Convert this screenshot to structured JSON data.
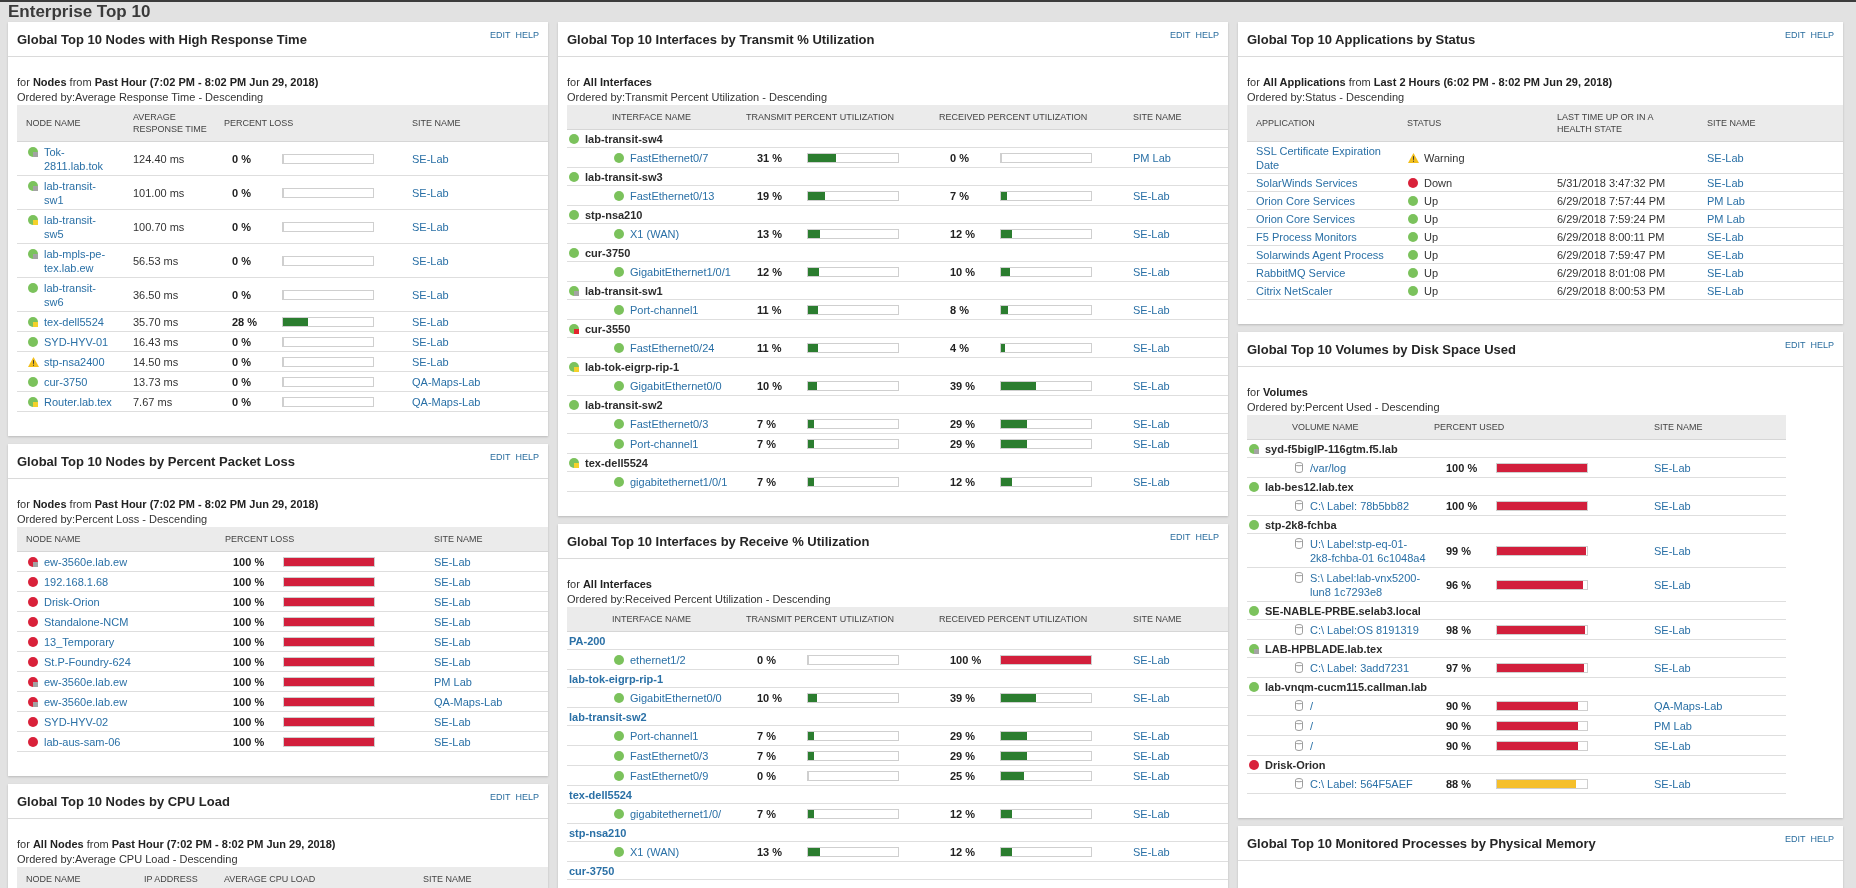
{
  "page": {
    "title": "Enterprise Top 10"
  },
  "panel_columns": [
    [
      {
        "kind": "response_time",
        "title": "Global Top 10 Nodes with High Response Time",
        "actions": [
          "EDIT",
          "HELP"
        ],
        "filter": "for **Nodes** from **Past Hour (7:02 PM - 8:02 PM Jun 29, 2018)**",
        "ordered_by": "Ordered by:Average Response Time - Descending",
        "columns": [
          "NODE NAME",
          "AVERAGE RESPONSE TIME",
          "PERCENT LOSS",
          "SITE NAME"
        ],
        "rows": [
          {
            "name": "Tok-2811.lab.tok",
            "warning": false,
            "color": "#7bc25c",
            "badge": {
              "color": "#a3a3a3"
            },
            "response_time": "124.40 ms",
            "loss": {
              "reading": "0 %",
              "level": 0
            },
            "site": "SE-Lab"
          },
          {
            "name": "lab-transit-sw1",
            "warning": false,
            "color": "#7bc25c",
            "badge": {
              "color": "#a3a3a3"
            },
            "response_time": "101.00 ms",
            "loss": {
              "reading": "0 %",
              "level": 0
            },
            "site": "SE-Lab"
          },
          {
            "name": "lab-transit-sw5",
            "warning": false,
            "color": "#7bc25c",
            "badge": {
              "color": "#f4d12b"
            },
            "response_time": "100.70 ms",
            "loss": {
              "reading": "0 %",
              "level": 0
            },
            "site": "SE-Lab"
          },
          {
            "name": "lab-mpls-pe-tex.lab.ew",
            "warning": false,
            "color": "#7bc25c",
            "badge": {
              "color": "#a3a3a3"
            },
            "response_time": "56.53 ms",
            "loss": {
              "reading": "0 %",
              "level": 0
            },
            "site": "SE-Lab"
          },
          {
            "name": "lab-transit-sw6",
            "warning": false,
            "color": "#7bc25c",
            "response_time": "36.50 ms",
            "loss": {
              "reading": "0 %",
              "level": 0
            },
            "site": "SE-Lab"
          },
          {
            "name": "tex-dell5524",
            "warning": false,
            "color": "#7bc25c",
            "badge": {
              "color": "#f4d12b"
            },
            "response_time": "35.70 ms",
            "loss": {
              "reading": "28 %",
              "level": 0.28
            },
            "site": "SE-Lab"
          },
          {
            "name": "SYD-HYV-01",
            "warning": false,
            "color": "#7bc25c",
            "response_time": "16.43 ms",
            "loss": {
              "reading": "0 %",
              "level": 0
            },
            "site": "SE-Lab"
          },
          {
            "name": "stp-nsa2400",
            "warning": true,
            "response_time": "14.50 ms",
            "loss": {
              "reading": "0 %",
              "level": 0
            },
            "site": "SE-Lab"
          },
          {
            "name": "cur-3750",
            "warning": false,
            "color": "#7bc25c",
            "response_time": "13.73 ms",
            "loss": {
              "reading": "0 %",
              "level": 0
            },
            "site": "QA-Maps-Lab"
          },
          {
            "name": "Router.lab.tex",
            "warning": false,
            "color": "#7bc25c",
            "badge": {
              "color": "#f4d12b"
            },
            "response_time": "7.67 ms",
            "loss": {
              "reading": "0 %",
              "level": 0
            },
            "site": "QA-Maps-Lab"
          }
        ]
      },
      {
        "kind": "packet_loss",
        "title": "Global Top 10 Nodes by Percent Packet Loss",
        "actions": [
          "EDIT",
          "HELP"
        ],
        "filter": "for **Nodes** from **Past Hour (7:02 PM - 8:02 PM Jun 29, 2018)**",
        "ordered_by": "Ordered by:Percent Loss - Descending",
        "columns": [
          "NODE NAME",
          "PERCENT LOSS",
          "SITE NAME"
        ],
        "rows": [
          {
            "name": "ew-3560e.lab.ew",
            "color": "#d9213a",
            "badge": {
              "color": "#a3a3a3"
            },
            "loss": {
              "reading": "100 %",
              "level": 1
            },
            "site": "SE-Lab"
          },
          {
            "name": "192.168.1.68",
            "color": "#d9213a",
            "loss": {
              "reading": "100 %",
              "level": 1
            },
            "site": "SE-Lab"
          },
          {
            "name": "Drisk-Orion",
            "color": "#d9213a",
            "loss": {
              "reading": "100 %",
              "level": 1
            },
            "site": "SE-Lab"
          },
          {
            "name": "Standalone-NCM",
            "color": "#d9213a",
            "loss": {
              "reading": "100 %",
              "level": 1
            },
            "site": "SE-Lab"
          },
          {
            "name": "13_Temporary",
            "color": "#d9213a",
            "loss": {
              "reading": "100 %",
              "level": 1
            },
            "site": "SE-Lab"
          },
          {
            "name": "St.P-Foundry-624",
            "color": "#d9213a",
            "loss": {
              "reading": "100 %",
              "level": 1
            },
            "site": "SE-Lab"
          },
          {
            "name": "ew-3560e.lab.ew",
            "color": "#d9213a",
            "badge": {
              "color": "#a3a3a3"
            },
            "loss": {
              "reading": "100 %",
              "level": 1
            },
            "site": "PM Lab"
          },
          {
            "name": "ew-3560e.lab.ew",
            "color": "#d9213a",
            "badge": {
              "color": "#a3a3a3"
            },
            "loss": {
              "reading": "100 %",
              "level": 1
            },
            "site": "QA-Maps-Lab"
          },
          {
            "name": "SYD-HYV-02",
            "color": "#d9213a",
            "loss": {
              "reading": "100 %",
              "level": 1
            },
            "site": "SE-Lab"
          },
          {
            "name": "lab-aus-sam-06",
            "color": "#d9213a",
            "loss": {
              "reading": "100 %",
              "level": 1
            },
            "site": "SE-Lab"
          }
        ]
      },
      {
        "kind": "cpu_load",
        "title": "Global Top 10 Nodes by CPU Load",
        "actions": [
          "EDIT",
          "HELP"
        ],
        "filter": "for **All Nodes** from **Past Hour (7:02 PM - 8:02 PM Jun 29, 2018)**",
        "ordered_by": "Ordered by:Average CPU Load - Descending",
        "columns": [
          "NODE NAME",
          "IP ADDRESS",
          "AVERAGE CPU LOAD",
          "SITE NAME"
        ]
      }
    ],
    [
      {
        "kind": "interfaces",
        "title": "Global Top 10 Interfaces by Transmit % Utilization",
        "actions": [
          "EDIT",
          "HELP"
        ],
        "filter": "for **All Interfaces**",
        "ordered_by": "Ordered by:Transmit Percent Utilization - Descending",
        "columns": [
          "INTERFACE NAME",
          "TRANSMIT PERCENT UTILIZATION",
          "RECEIVED PERCENT UTILIZATION",
          "SITE NAME"
        ],
        "group_links": false,
        "groups": [
          {
            "name": "lab-transit-sw4",
            "color": "#7bc25c",
            "interfaces": [
              {
                "name": "FastEthernet0/7",
                "color": "#7bc25c",
                "transmit": {
                  "reading": "31 %",
                  "level": 0.31
                },
                "received": {
                  "reading": "0 %",
                  "level": 0
                },
                "site": "PM Lab"
              }
            ]
          },
          {
            "name": "lab-transit-sw3",
            "color": "#7bc25c",
            "interfaces": [
              {
                "name": "FastEthernet0/13",
                "color": "#7bc25c",
                "transmit": {
                  "reading": "19 %",
                  "level": 0.19
                },
                "received": {
                  "reading": "7 %",
                  "level": 0.07
                },
                "site": "SE-Lab"
              }
            ]
          },
          {
            "name": "stp-nsa210",
            "color": "#7bc25c",
            "interfaces": [
              {
                "name": "X1 (WAN)",
                "color": "#7bc25c",
                "transmit": {
                  "reading": "13 %",
                  "level": 0.13
                },
                "received": {
                  "reading": "12 %",
                  "level": 0.12
                },
                "site": "SE-Lab"
              }
            ]
          },
          {
            "name": "cur-3750",
            "color": "#7bc25c",
            "interfaces": [
              {
                "name": "GigabitEthernet1/0/1",
                "color": "#7bc25c",
                "transmit": {
                  "reading": "12 %",
                  "level": 0.12
                },
                "received": {
                  "reading": "10 %",
                  "level": 0.1
                },
                "site": "SE-Lab"
              }
            ]
          },
          {
            "name": "lab-transit-sw1",
            "color": "#7bc25c",
            "badge": {
              "color": "#a3a3a3"
            },
            "interfaces": [
              {
                "name": "Port-channel1",
                "color": "#7bc25c",
                "transmit": {
                  "reading": "11 %",
                  "level": 0.11
                },
                "received": {
                  "reading": "8 %",
                  "level": 0.08
                },
                "site": "SE-Lab"
              }
            ]
          },
          {
            "name": "cur-3550",
            "color": "#7bc25c",
            "badge": {
              "color": "#e3262f"
            },
            "interfaces": [
              {
                "name": "FastEthernet0/24",
                "color": "#7bc25c",
                "transmit": {
                  "reading": "11 %",
                  "level": 0.11
                },
                "received": {
                  "reading": "4 %",
                  "level": 0.04
                },
                "site": "SE-Lab"
              }
            ]
          },
          {
            "name": "lab-tok-eigrp-rip-1",
            "color": "#7bc25c",
            "badge": {
              "color": "#f4d12b"
            },
            "interfaces": [
              {
                "name": "GigabitEthernet0/0",
                "color": "#7bc25c",
                "transmit": {
                  "reading": "10 %",
                  "level": 0.1
                },
                "received": {
                  "reading": "39 %",
                  "level": 0.39
                },
                "site": "SE-Lab"
              }
            ]
          },
          {
            "name": "lab-transit-sw2",
            "color": "#7bc25c",
            "interfaces": [
              {
                "name": "FastEthernet0/3",
                "color": "#7bc25c",
                "transmit": {
                  "reading": "7 %",
                  "level": 0.07
                },
                "received": {
                  "reading": "29 %",
                  "level": 0.29
                },
                "site": "SE-Lab"
              },
              {
                "name": "Port-channel1",
                "color": "#7bc25c",
                "transmit": {
                  "reading": "7 %",
                  "level": 0.07
                },
                "received": {
                  "reading": "29 %",
                  "level": 0.29
                },
                "site": "SE-Lab"
              }
            ]
          },
          {
            "name": "tex-dell5524",
            "color": "#7bc25c",
            "badge": {
              "color": "#f4d12b"
            },
            "interfaces": [
              {
                "name": "gigabitethernet1/0/1",
                "color": "#7bc25c",
                "transmit": {
                  "reading": "7 %",
                  "level": 0.07
                },
                "received": {
                  "reading": "12 %",
                  "level": 0.12
                },
                "site": "SE-Lab"
              }
            ]
          }
        ]
      },
      {
        "kind": "interfaces",
        "title": "Global Top 10 Interfaces by Receive % Utilization",
        "actions": [
          "EDIT",
          "HELP"
        ],
        "filter": "for **All Interfaces**",
        "ordered_by": "Ordered by:Received Percent Utilization - Descending",
        "columns": [
          "INTERFACE NAME",
          "TRANSMIT PERCENT UTILIZATION",
          "RECEIVED PERCENT UTILIZATION",
          "SITE NAME"
        ],
        "group_links": true,
        "groups": [
          {
            "name": "PA-200",
            "interfaces": [
              {
                "name": "ethernet1/2",
                "color": "#7bc25c",
                "transmit": {
                  "reading": "0 %",
                  "level": 0
                },
                "received": {
                  "reading": "100 %",
                  "level": 1
                },
                "site": "SE-Lab"
              }
            ]
          },
          {
            "name": "lab-tok-eigrp-rip-1",
            "interfaces": [
              {
                "name": "GigabitEthernet0/0",
                "color": "#7bc25c",
                "transmit": {
                  "reading": "10 %",
                  "level": 0.1
                },
                "received": {
                  "reading": "39 %",
                  "level": 0.39
                },
                "site": "SE-Lab"
              }
            ]
          },
          {
            "name": "lab-transit-sw2",
            "interfaces": [
              {
                "name": "Port-channel1",
                "color": "#7bc25c",
                "transmit": {
                  "reading": "7 %",
                  "level": 0.07
                },
                "received": {
                  "reading": "29 %",
                  "level": 0.29
                },
                "site": "SE-Lab"
              },
              {
                "name": "FastEthernet0/3",
                "color": "#7bc25c",
                "transmit": {
                  "reading": "7 %",
                  "level": 0.07
                },
                "received": {
                  "reading": "29 %",
                  "level": 0.29
                },
                "site": "SE-Lab"
              },
              {
                "name": "FastEthernet0/9",
                "color": "#7bc25c",
                "transmit": {
                  "reading": "0 %",
                  "level": 0
                },
                "received": {
                  "reading": "25 %",
                  "level": 0.25
                },
                "site": "SE-Lab"
              }
            ]
          },
          {
            "name": "tex-dell5524",
            "interfaces": [
              {
                "name": "gigabitethernet1/0/",
                "color": "#7bc25c",
                "transmit": {
                  "reading": "7 %",
                  "level": 0.07
                },
                "received": {
                  "reading": "12 %",
                  "level": 0.12
                },
                "site": "SE-Lab"
              }
            ]
          },
          {
            "name": "stp-nsa210",
            "interfaces": [
              {
                "name": "X1 (WAN)",
                "color": "#7bc25c",
                "transmit": {
                  "reading": "13 %",
                  "level": 0.13
                },
                "received": {
                  "reading": "12 %",
                  "level": 0.12
                },
                "site": "SE-Lab"
              }
            ]
          },
          {
            "name": "cur-3750"
          }
        ]
      }
    ],
    [
      {
        "kind": "applications",
        "title": "Global Top 10 Applications by Status",
        "actions": [
          "EDIT",
          "HELP"
        ],
        "filter": "for **All Applications** from **Last 2 Hours (6:02 PM - 8:02 PM Jun 29, 2018)**",
        "ordered_by": "Ordered by:Status - Descending",
        "columns": [
          "APPLICATION",
          "STATUS",
          "LAST TIME UP OR IN A HEALTH STATE",
          "SITE NAME"
        ],
        "rows": [
          {
            "name": "SSL Certificate Expiration Date",
            "warning": true,
            "status_text": "Warning",
            "site": "SE-Lab"
          },
          {
            "name": "SolarWinds Services",
            "warning": false,
            "color": "#d9213a",
            "status_text": "Down",
            "last_up": "5/31/2018 3:47:32 PM",
            "site": "SE-Lab"
          },
          {
            "name": "Orion Core Services",
            "warning": false,
            "color": "#7bc25c",
            "status_text": "Up",
            "last_up": "6/29/2018 7:57:44 PM",
            "site": "PM Lab"
          },
          {
            "name": "Orion Core Services",
            "warning": false,
            "color": "#7bc25c",
            "status_text": "Up",
            "last_up": "6/29/2018 7:59:24 PM",
            "site": "PM Lab"
          },
          {
            "name": "F5 Process Monitors",
            "warning": false,
            "color": "#7bc25c",
            "status_text": "Up",
            "last_up": "6/29/2018 8:00:11 PM",
            "site": "SE-Lab"
          },
          {
            "name": "Solarwinds Agent Process",
            "warning": false,
            "color": "#7bc25c",
            "status_text": "Up",
            "last_up": "6/29/2018 7:59:47 PM",
            "site": "SE-Lab"
          },
          {
            "name": "RabbitMQ Service",
            "warning": false,
            "color": "#7bc25c",
            "status_text": "Up",
            "last_up": "6/29/2018 8:01:08 PM",
            "site": "SE-Lab"
          },
          {
            "name": "Citrix NetScaler",
            "warning": false,
            "color": "#7bc25c",
            "status_text": "Up",
            "last_up": "6/29/2018 8:00:53 PM",
            "site": "SE-Lab"
          }
        ]
      },
      {
        "kind": "volumes",
        "title": "Global Top 10 Volumes by Disk Space Used",
        "actions": [
          "EDIT",
          "HELP"
        ],
        "filter": "for **Volumes**",
        "ordered_by": "Ordered by:Percent Used - Descending",
        "columns": [
          "VOLUME NAME",
          "PERCENT USED",
          "SITE NAME"
        ],
        "groups": [
          {
            "name": "syd-f5bigIP-116gtm.f5.lab",
            "color": "#7bc25c",
            "badge": {
              "color": "#a3a3a3"
            },
            "volumes": [
              {
                "name": "/var/log",
                "used": {
                  "reading": "100 %",
                  "level": 1
                },
                "site": "SE-Lab"
              }
            ]
          },
          {
            "name": "lab-bes12.lab.tex",
            "color": "#7bc25c",
            "volumes": [
              {
                "name": "C:\\ Label: 78b5bb82",
                "used": {
                  "reading": "100 %",
                  "level": 1
                },
                "site": "SE-Lab"
              }
            ]
          },
          {
            "name": "stp-2k8-fchba",
            "color": "#7bc25c",
            "volumes": [
              {
                "name": "U:\\ Label:stp-eq-01-2k8-fchba-01 6c1048a4",
                "used": {
                  "reading": "99 %",
                  "level": 0.99
                },
                "site": "SE-Lab"
              },
              {
                "name": "S:\\ Label:lab-vnx5200-lun8 1c7293e8",
                "used": {
                  "reading": "96 %",
                  "level": 0.96
                },
                "site": "SE-Lab"
              }
            ]
          },
          {
            "name": "SE-NABLE-PRBE.selab3.local",
            "color": "#7bc25c",
            "volumes": [
              {
                "name": "C:\\ Label:OS 8191319",
                "used": {
                  "reading": "98 %",
                  "level": 0.98
                },
                "site": "SE-Lab"
              }
            ]
          },
          {
            "name": "LAB-HPBLADE.lab.tex",
            "color": "#7bc25c",
            "badge": {
              "color": "#a3a3a3"
            },
            "volumes": [
              {
                "name": "C:\\ Label: 3add7231",
                "used": {
                  "reading": "97 %",
                  "level": 0.97
                },
                "site": "SE-Lab"
              }
            ]
          },
          {
            "name": "lab-vnqm-cucm115.callman.lab",
            "color": "#7bc25c",
            "volumes": [
              {
                "name": "/",
                "used": {
                  "reading": "90 %",
                  "level": 0.9
                },
                "site": "QA-Maps-Lab"
              },
              {
                "name": "/",
                "used": {
                  "reading": "90 %",
                  "level": 0.9
                },
                "site": "PM Lab"
              },
              {
                "name": "/",
                "used": {
                  "reading": "90 %",
                  "level": 0.9
                },
                "site": "SE-Lab"
              }
            ]
          },
          {
            "name": "Drisk-Orion",
            "color": "#d9213a",
            "volumes": [
              {
                "name": "C:\\ Label: 564F5AEF",
                "used": {
                  "reading": "88 %",
                  "level": 0.88
                },
                "site": "SE-Lab"
              }
            ]
          }
        ]
      },
      {
        "kind": "processes",
        "title": "Global Top 10 Monitored Processes by Physical Memory",
        "actions": [
          "EDIT",
          "HELP"
        ]
      }
    ]
  ]
}
